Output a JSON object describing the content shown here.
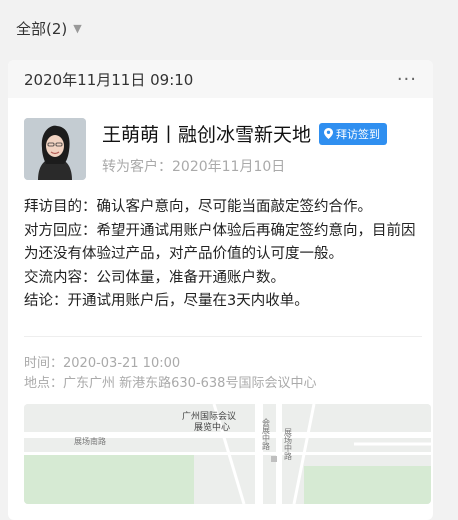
{
  "filter": {
    "label": "全部(2)",
    "chevron_icon": "chevron-down-icon"
  },
  "record": {
    "datetime": "2020年11月11日 09:10",
    "more_icon": "more-horizontal-icon",
    "name": "王萌萌丨融创冰雪新天地",
    "badge": "拜访签到",
    "badge_icon": "location-pin-icon",
    "convert_label": "转为客户：",
    "convert_date": "2020年11月10日",
    "lines": [
      "拜访目的：确认客户意向，尽可能当面敲定签约合作。",
      "对方回应：希望开通试用账户体验后再确定签约意向，目前因为还没有体验过产品，对产品价值的认可度一般。",
      "交流内容：公司体量，准备开通账户数。",
      "结论：开通试用账户后，尽量在3天内收单。"
    ],
    "time": "时间：2020-03-21 10:00",
    "location": "地点：广东广州 新港东路630-638号国际会议中心",
    "map": {
      "poi": "广州国际会议展览中心",
      "road_labels": [
        "展场南路",
        "会展中路",
        "展场中路"
      ]
    }
  },
  "colors": {
    "accent": "#2f8ff0",
    "muted": "#aaaaaa",
    "bg": "#f2f2f2"
  }
}
